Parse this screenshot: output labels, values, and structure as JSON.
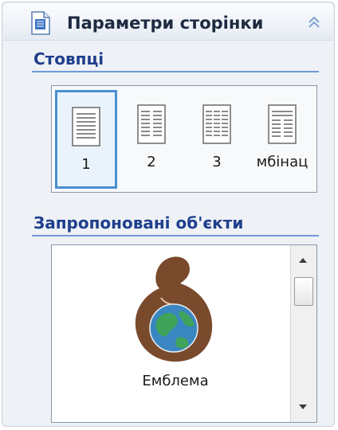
{
  "panel": {
    "title": "Параметри сторінки",
    "icon": "document-icon",
    "collapse_icon": "double-chevron-up-icon"
  },
  "columns_section": {
    "title": "Стовпці",
    "options": [
      {
        "label": "1",
        "selected": true
      },
      {
        "label": "2",
        "selected": false
      },
      {
        "label": "3",
        "selected": false
      },
      {
        "label": "мбінац",
        "selected": false
      }
    ]
  },
  "objects_section": {
    "title": "Запропоновані об'єкти",
    "items": [
      {
        "label": "Емблема",
        "icon": "emblem-globe-icon"
      }
    ]
  },
  "colors": {
    "accent": "#4a8fd0",
    "section_title": "#1e3f8c",
    "emblem_brown": "#7a4a2d",
    "globe_blue": "#3a86c0",
    "globe_green": "#3fa35a"
  }
}
